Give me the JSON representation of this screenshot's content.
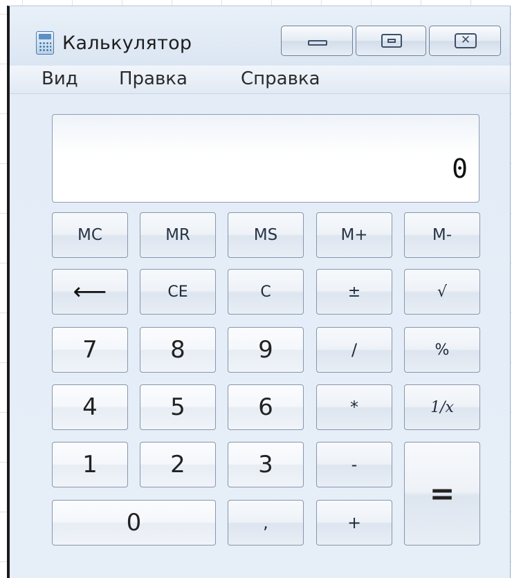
{
  "window": {
    "title": "Калькулятор",
    "icon": "calculator-icon"
  },
  "menu": {
    "items": [
      "Вид",
      "Правка",
      "Справка"
    ]
  },
  "display": {
    "value": "0"
  },
  "keys": {
    "mc": "MC",
    "mr": "MR",
    "ms": "MS",
    "mplus": "M+",
    "mminus": "M-",
    "backspace": "⟵",
    "ce": "CE",
    "c": "C",
    "plusminus": "±",
    "sqrt": "√",
    "d7": "7",
    "d8": "8",
    "d9": "9",
    "div": "/",
    "percent": "%",
    "d4": "4",
    "d5": "5",
    "d6": "6",
    "mul": "*",
    "recip": "1/x",
    "d1": "1",
    "d2": "2",
    "d3": "3",
    "sub": "-",
    "equals": "=",
    "d0": "0",
    "dot": ",",
    "add": "+"
  },
  "colors": {
    "window_bg": "#e4edf7",
    "border": "#8796ab"
  }
}
